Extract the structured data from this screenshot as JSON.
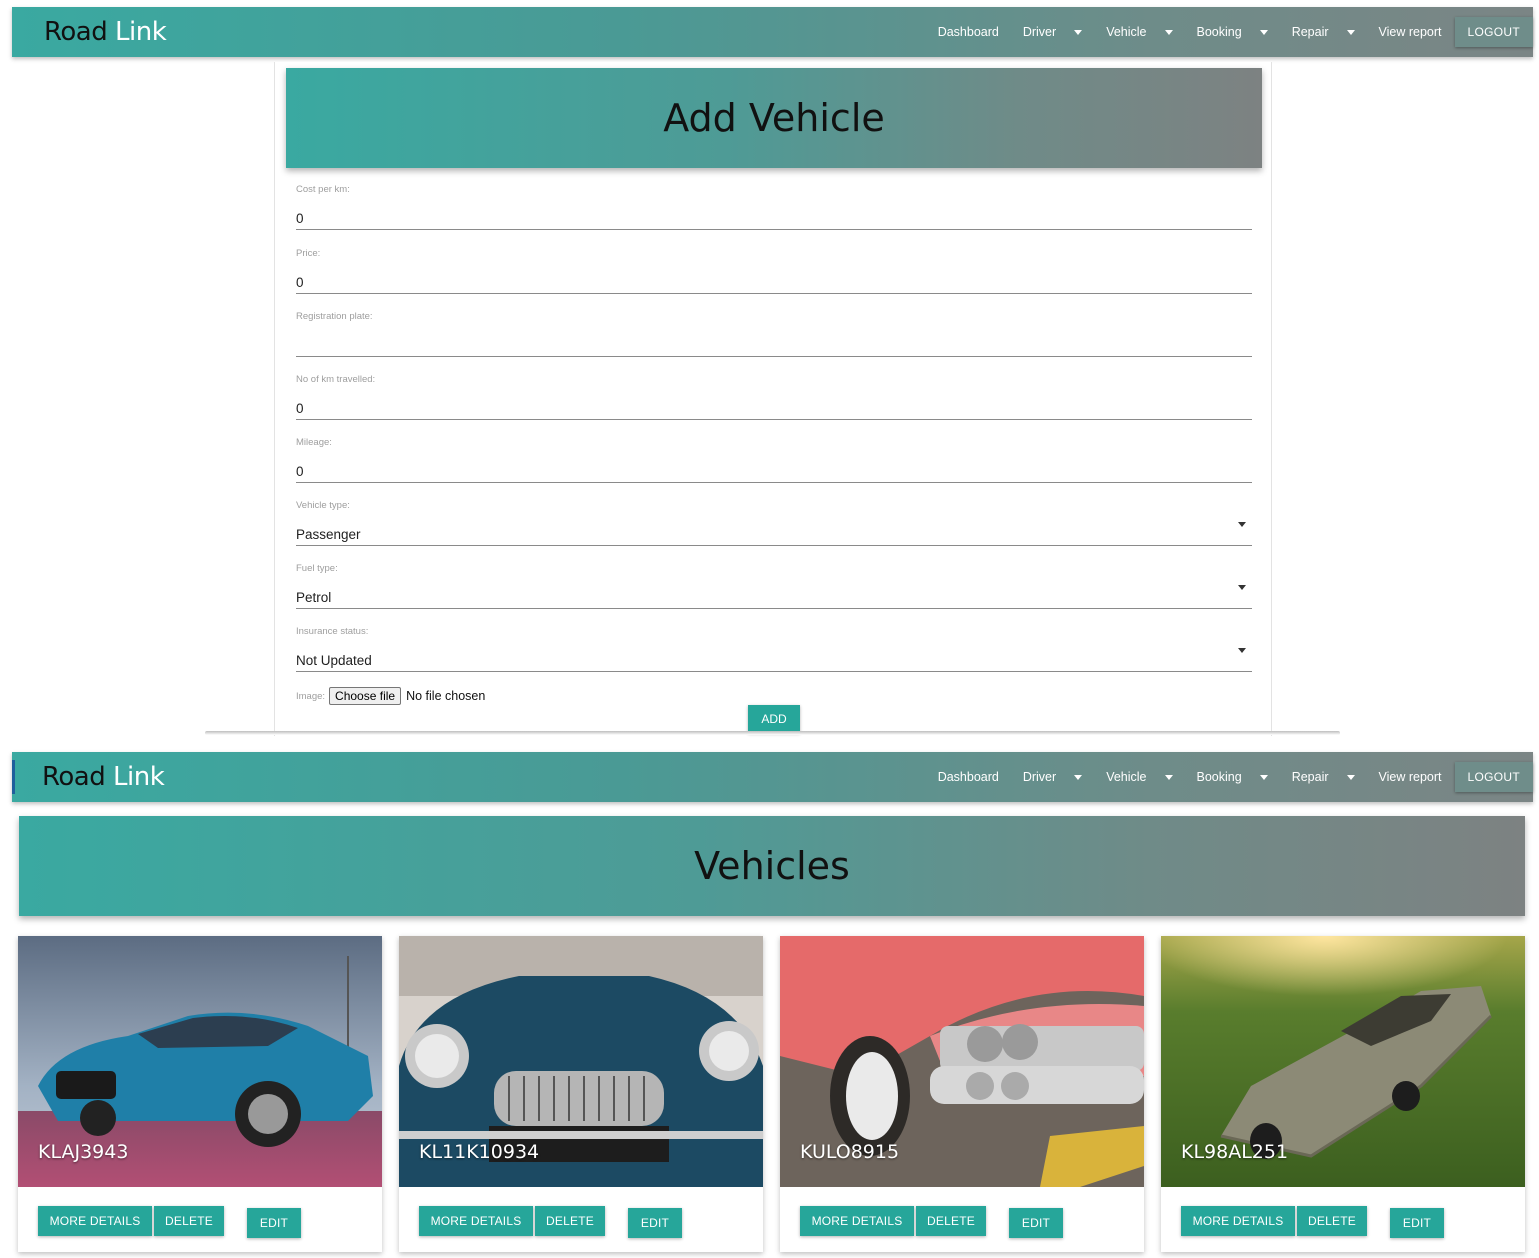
{
  "top_screen": {
    "navbar": {
      "brand_part1": "Road",
      "brand_part2": "Link",
      "links": [
        "Dashboard",
        "Driver",
        "Vehicle",
        "Booking",
        "Repair",
        "View report"
      ],
      "logout": "LOGOUT"
    },
    "form": {
      "title": "Add Vehicle",
      "fields": {
        "cost_per_km": {
          "label": "Cost per km:",
          "value": "0"
        },
        "price": {
          "label": "Price:",
          "value": "0"
        },
        "registration_plate": {
          "label": "Registration plate:",
          "value": ""
        },
        "km_travelled": {
          "label": "No of km travelled:",
          "value": "0"
        },
        "mileage": {
          "label": "Mileage:",
          "value": "0"
        },
        "vehicle_type": {
          "label": "Vehicle type:",
          "value": "Passenger"
        },
        "fuel_type": {
          "label": "Fuel type:",
          "value": "Petrol"
        },
        "insurance_status": {
          "label": "Insurance status:",
          "value": "Not Updated"
        }
      },
      "image": {
        "label": "Image:",
        "choose_button": "Choose file",
        "status": "No file chosen"
      },
      "submit": "ADD"
    }
  },
  "bottom_screen": {
    "navbar": {
      "brand_part1": "Road",
      "brand_part2": "Link",
      "links": [
        "Dashboard",
        "Driver",
        "Vehicle",
        "Booking",
        "Repair",
        "View report"
      ],
      "logout": "LOGOUT"
    },
    "title": "Vehicles",
    "cards": [
      {
        "plate": "KLAJ3943",
        "more": "MORE DETAILS",
        "delete": "DELETE",
        "edit": "EDIT"
      },
      {
        "plate": "KL11K10934",
        "more": "MORE DETAILS",
        "delete": "DELETE",
        "edit": "EDIT"
      },
      {
        "plate": "KULO8915",
        "more": "MORE DETAILS",
        "delete": "DELETE",
        "edit": "EDIT"
      },
      {
        "plate": "KL98AL251",
        "more": "MORE DETAILS",
        "delete": "DELETE",
        "edit": "EDIT"
      }
    ]
  },
  "colors": {
    "accent": "#26a69a",
    "navbar_start": "#3aa9a1",
    "navbar_end": "#7b8585"
  }
}
